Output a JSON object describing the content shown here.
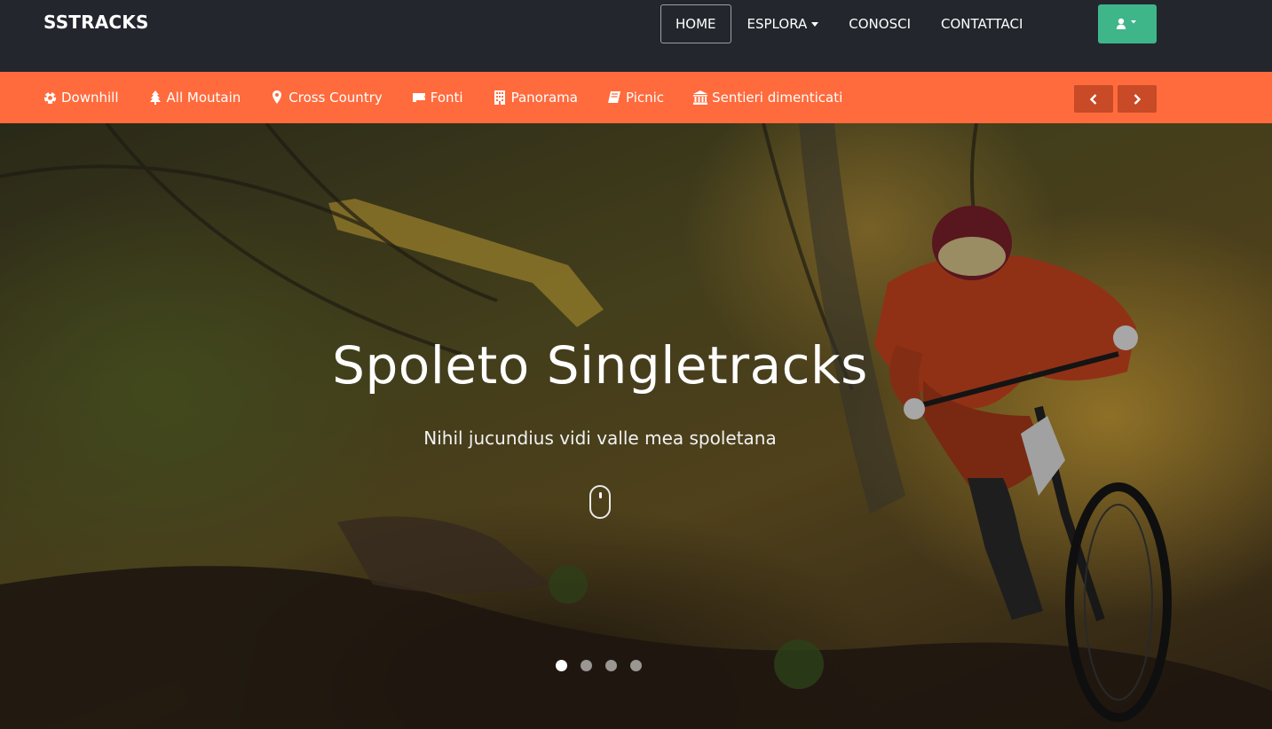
{
  "brand": "SSTRACKS",
  "nav": {
    "home": "HOME",
    "explore": "ESPLORA",
    "about": "CONOSCI",
    "contact": "CONTATTACI",
    "user_icon": "user-icon",
    "accent_color": "#3fb58a"
  },
  "categories": {
    "bar_color": "#ff6b3d",
    "items": [
      {
        "label": "Downhill",
        "icon": "soccer-ball-icon"
      },
      {
        "label": "All Moutain",
        "icon": "tree-icon"
      },
      {
        "label": "Cross Country",
        "icon": "map-marker-icon"
      },
      {
        "label": "Fonti",
        "icon": "ticket-icon"
      },
      {
        "label": "Panorama",
        "icon": "building-icon"
      },
      {
        "label": "Picnic",
        "icon": "book-icon"
      },
      {
        "label": "Sentieri dimenticati",
        "icon": "bank-icon"
      }
    ],
    "prev_icon": "chevron-left-icon",
    "next_icon": "chevron-right-icon"
  },
  "hero": {
    "title": "Spoleto Singletracks",
    "subtitle": "Nihil jucundius vidi valle mea spoletana",
    "slides_total": 4,
    "active_slide": 1
  }
}
